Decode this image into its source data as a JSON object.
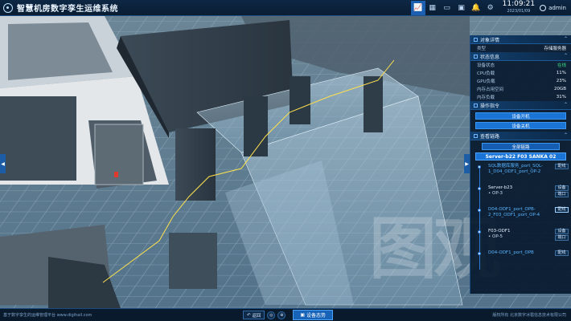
{
  "app": {
    "title": "智慧机房数字孪生运维系统",
    "time": "11:09:21",
    "date": "2023/01/09",
    "user": "admin"
  },
  "toolbar_icons": [
    "chart-icon",
    "grid-icon",
    "monitor-icon",
    "image-icon",
    "bell-icon",
    "gear-icon"
  ],
  "panel": {
    "object_detail": {
      "title": "对象详情",
      "rows": [
        {
          "k": "类型",
          "v": "存储服务器"
        }
      ]
    },
    "status": {
      "title": "状态信息",
      "rows": [
        {
          "k": "设备状态",
          "v": "在线"
        },
        {
          "k": "CPU负载",
          "v": "11%"
        },
        {
          "k": "GPU负载",
          "v": "23%"
        },
        {
          "k": "内存占用空间",
          "v": "20GB"
        },
        {
          "k": "内存负载",
          "v": "31%"
        }
      ]
    },
    "ops": {
      "title": "操作指令",
      "buttons": [
        "设备开机",
        "设备关机"
      ]
    },
    "links": {
      "title": "查看链路",
      "all_button": "全部链路",
      "server": "Server-b22 F03 SANKA 02",
      "chain": [
        {
          "name": "SQL数据库服务_port_SQL-1_D04_ODF1_port_OP-2",
          "sub": "",
          "buttons": [
            "配线"
          ]
        },
        {
          "name": "Server-b23",
          "sub": "• OP-3",
          "buttons": [
            "设备",
            "端口"
          ]
        },
        {
          "name": "D04-ODF1_port_OPB-2_F03_ODF1_port_OP-4",
          "sub": "",
          "buttons": [
            "配线"
          ]
        },
        {
          "name": "F03-ODF1",
          "sub": "• OP-5",
          "buttons": [
            "设备",
            "端口"
          ]
        },
        {
          "name": "D04-ODF1_port_OPB",
          "sub": "",
          "buttons": [
            "配线"
          ]
        }
      ]
    }
  },
  "bottom": {
    "left_text": "基于数字孪生的运维管理平台 www.digihail.com",
    "right_text": "版权所有 北京数字冰雹信息技术有限公司",
    "back": "返回",
    "main_button": "设备态势"
  },
  "watermark": "图观"
}
